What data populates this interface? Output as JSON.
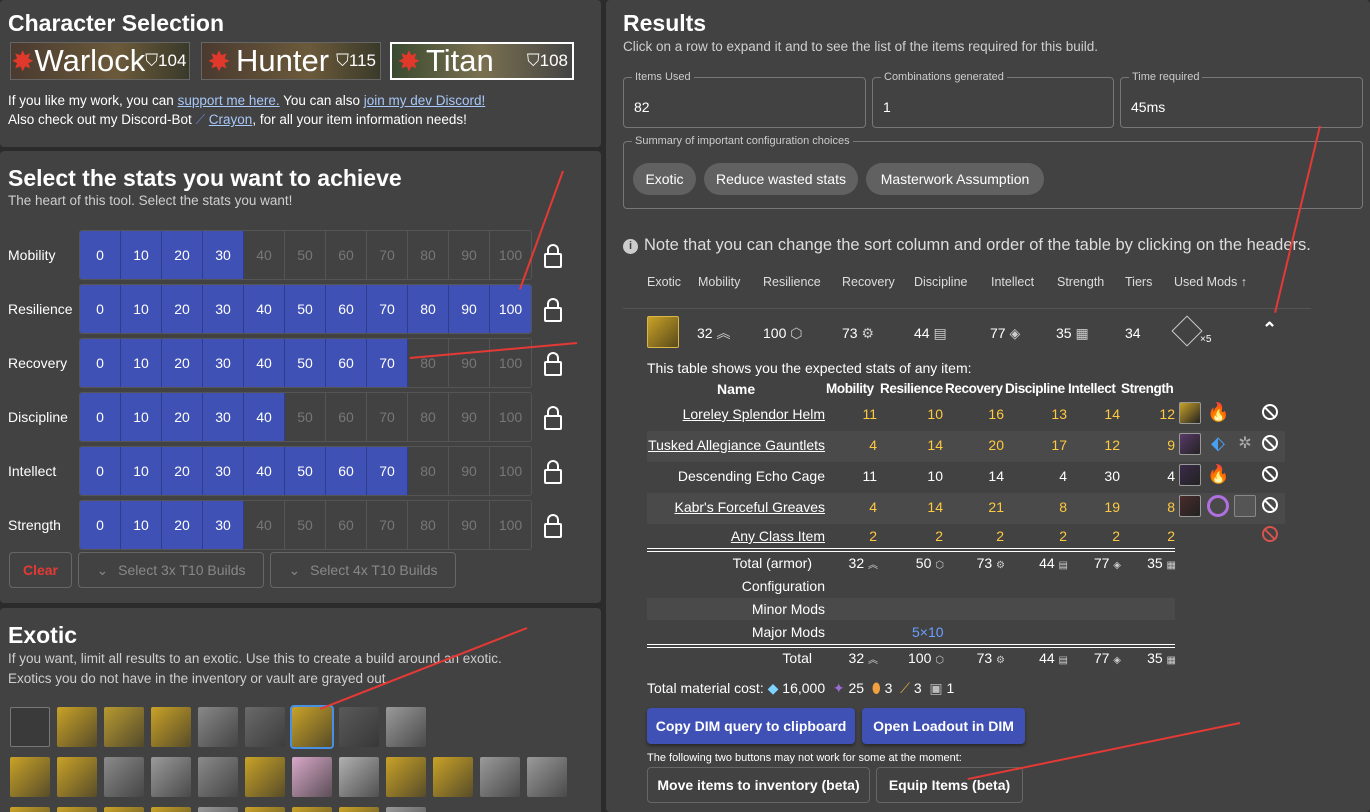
{
  "char": {
    "title": "Character Selection",
    "chars": [
      {
        "name": "Warlock",
        "power": "104"
      },
      {
        "name": "Hunter",
        "power": "115"
      },
      {
        "name": "Titan",
        "power": "108"
      }
    ],
    "line1_pre": "If you like my work, you can ",
    "line1_link1": "support me here.",
    "line1_mid": " You can also ",
    "line1_link2": "join my dev Discord!",
    "line2_pre": "Also check out my Discord-Bot ",
    "line2_link": "Crayon",
    "line2_post": ", for all your item information needs!"
  },
  "stats": {
    "title": "Select the stats you want to achieve",
    "subtitle": "The heart of this tool. Select the stats you want!",
    "ticks": [
      "0",
      "10",
      "20",
      "30",
      "40",
      "50",
      "60",
      "70",
      "80",
      "90",
      "100"
    ],
    "rows": [
      {
        "label": "Mobility",
        "value": 30
      },
      {
        "label": "Resilience",
        "value": 100
      },
      {
        "label": "Recovery",
        "value": 70
      },
      {
        "label": "Discipline",
        "value": 40
      },
      {
        "label": "Intellect",
        "value": 70
      },
      {
        "label": "Strength",
        "value": 30
      }
    ],
    "clear": "Clear",
    "t10_3": "Select 3x T10 Builds",
    "t10_4": "Select 4x T10 Builds"
  },
  "exotic": {
    "title": "Exotic",
    "line1": "If you want, limit all results to an exotic. Use this to create a build around an exotic.",
    "line2": "Exotics you do not have in the inventory or vault are grayed out."
  },
  "results": {
    "title": "Results",
    "subtitle": "Click on a row to expand it and to see the list of the items required for this build.",
    "items_used_label": "Items Used",
    "items_used": "82",
    "combos_label": "Combinations generated",
    "combos": "1",
    "time_label": "Time required",
    "time": "45ms",
    "summary_label": "Summary of important configuration choices",
    "chips": [
      "Exotic",
      "Reduce wasted stats",
      "Masterwork Assumption"
    ],
    "note": "Note that you can change the sort column and order of the table by clicking on the headers.",
    "headers": [
      "Exotic",
      "Mobility",
      "Resilience",
      "Recovery",
      "Discipline",
      "Intellect",
      "Strength",
      "Tiers",
      "Used Mods ↑"
    ],
    "row": {
      "mob": "32",
      "res": "100",
      "rec": "73",
      "dis": "44",
      "int": "77",
      "str": "35",
      "tiers": "34",
      "mods": "×5"
    },
    "expl": "This table shows you the expected stats of any item:",
    "sub_headers": [
      "Name",
      "Mobility",
      "Resilience",
      "Recovery",
      "Discipline",
      "Intellect",
      "Strength"
    ],
    "items": [
      {
        "name": "Loreley Splendor Helm",
        "vals": [
          "11",
          "10",
          "16",
          "13",
          "14",
          "12"
        ]
      },
      {
        "name": "Tusked Allegiance Gauntlets",
        "vals": [
          "4",
          "14",
          "20",
          "17",
          "12",
          "9"
        ]
      },
      {
        "name": "Descending Echo Cage",
        "vals": [
          "11",
          "10",
          "14",
          "4",
          "30",
          "4"
        ]
      },
      {
        "name": "Kabr's Forceful Greaves",
        "vals": [
          "4",
          "14",
          "21",
          "8",
          "19",
          "8"
        ]
      },
      {
        "name": "Any Class Item",
        "vals": [
          "2",
          "2",
          "2",
          "2",
          "2",
          "2"
        ]
      }
    ],
    "total_armor_label": "Total (armor)",
    "total_armor": [
      "32",
      "50",
      "73",
      "44",
      "77",
      "35"
    ],
    "config_label": "Configuration",
    "minor_label": "Minor Mods",
    "major_label": "Major Mods",
    "major_val": "5×10",
    "total_label": "Total",
    "total": [
      "32",
      "100",
      "73",
      "44",
      "77",
      "35"
    ],
    "mat_label": "Total material cost:",
    "mat_glimmer": "16,000",
    "mat_a": "25",
    "mat_b": "3",
    "mat_c": "3",
    "mat_d": "1",
    "btn_dim": "Copy DIM query to clipboard",
    "btn_loadout": "Open Loadout in DIM",
    "warn": "The following two buttons may not work for some at the moment:",
    "btn_move": "Move items to inventory (beta)",
    "btn_equip": "Equip Items (beta)"
  },
  "colors": {
    "accent": "#3f51b5",
    "gold": "#ffc940",
    "panel": "#424242"
  }
}
